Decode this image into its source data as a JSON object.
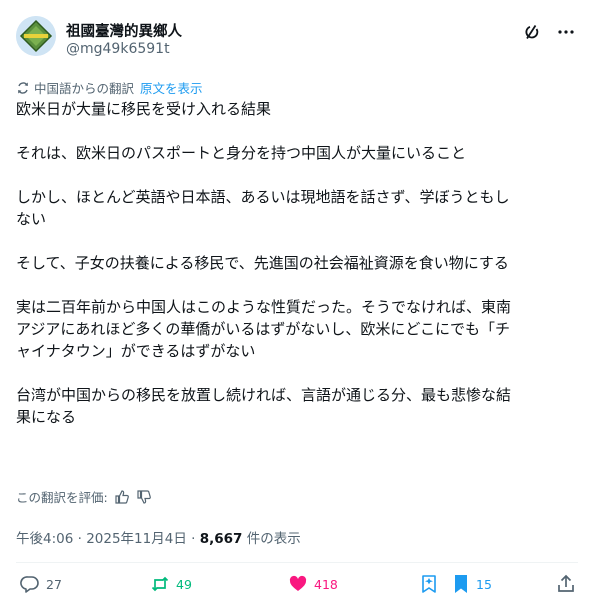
{
  "author": {
    "display_name": "祖國臺灣的異鄉人",
    "handle": "@mg49k6591t"
  },
  "translation": {
    "label": "中国語からの翻訳",
    "show_original": "原文を表示"
  },
  "post": {
    "lines": [
      "欧米日が大量に移民を受け入れる結果",
      "",
      "それは、欧米日のパスポートと身分を持つ中国人が大量にいること",
      "",
      "しかし、ほとんど英語や日本語、あるいは現地語を話さず、学ぼうともし",
      "ない",
      "",
      "そして、子女の扶養による移民で、先進国の社会福祉資源を食い物にする",
      "",
      "実は二百年前から中国人はこのような性質だった。そうでなければ、東南",
      "アジアにあれほど多くの華僑がいるはずがないし、欧米にどこにでも「チ",
      "ャイナタウン」ができるはずがない",
      "",
      "台湾が中国からの移民を放置し続ければ、言語が通じる分、最も悲惨な結",
      "果になる"
    ]
  },
  "rate_translation": "この翻訳を評価:",
  "meta": {
    "time": "午後4:06",
    "sep1": " · ",
    "date": "2025年11月4日",
    "sep2": " · ",
    "views": "8,667",
    "views_label": " 件の表示"
  },
  "actions": {
    "replies": "27",
    "reposts": "49",
    "likes": "418",
    "bookmarks": "15"
  },
  "colors": {
    "accent": "#1d9bf0",
    "repost": "#00ba7c",
    "like": "#f91880",
    "muted": "#536471"
  }
}
